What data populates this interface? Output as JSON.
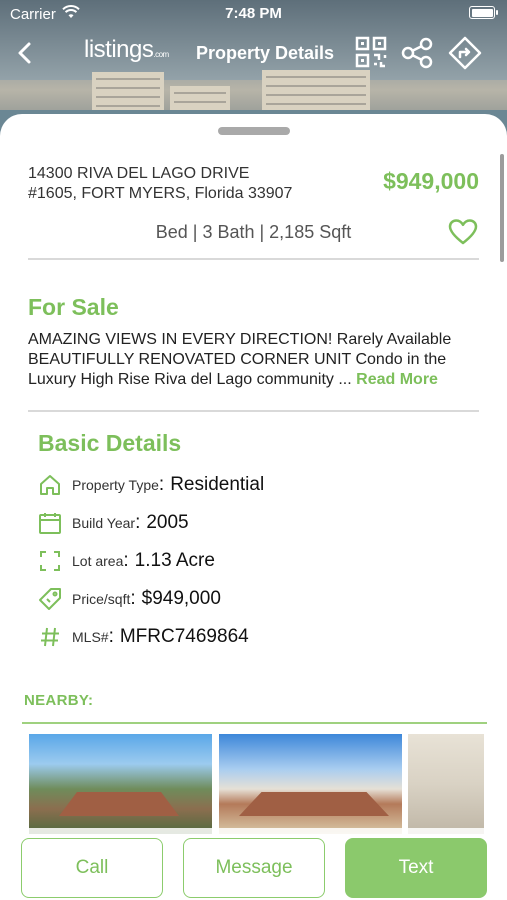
{
  "status_bar": {
    "carrier": "Carrier",
    "time": "7:48 PM"
  },
  "nav": {
    "logo": "listings",
    "logo_suffix": ".com",
    "title": "Property Details"
  },
  "property": {
    "address_line1": "14300 RIVA DEL LAGO DRIVE",
    "address_line2": "#1605, FORT MYERS, Florida 33907",
    "price": "$949,000",
    "specs": "Bed | 3 Bath | 2,185 Sqft",
    "status": "For Sale",
    "description": "AMAZING VIEWS IN EVERY DIRECTION! Rarely Available BEAUTIFULLY RENOVATED CORNER UNIT Condo in the Luxury High Rise Riva del Lago community ... ",
    "read_more": "Read More"
  },
  "basic_details": {
    "title": "Basic Details",
    "rows": [
      {
        "icon": "home-icon",
        "label": "Property Type",
        "value": "Residential"
      },
      {
        "icon": "calendar-icon",
        "label": "Build Year",
        "value": "2005"
      },
      {
        "icon": "expand-icon",
        "label": "Lot area",
        "value": "1.13 Acre"
      },
      {
        "icon": "price-tag-icon",
        "label": "Price/sqft",
        "value": "$949,000"
      },
      {
        "icon": "hash-icon",
        "label": "MLS#",
        "value": "MFRC7469864"
      }
    ]
  },
  "nearby": {
    "title": "NEARBY:"
  },
  "actions": {
    "call": "Call",
    "message": "Message",
    "text": "Text"
  },
  "colors": {
    "accent": "#7dbf5b",
    "button_fill": "#8bc96c"
  }
}
